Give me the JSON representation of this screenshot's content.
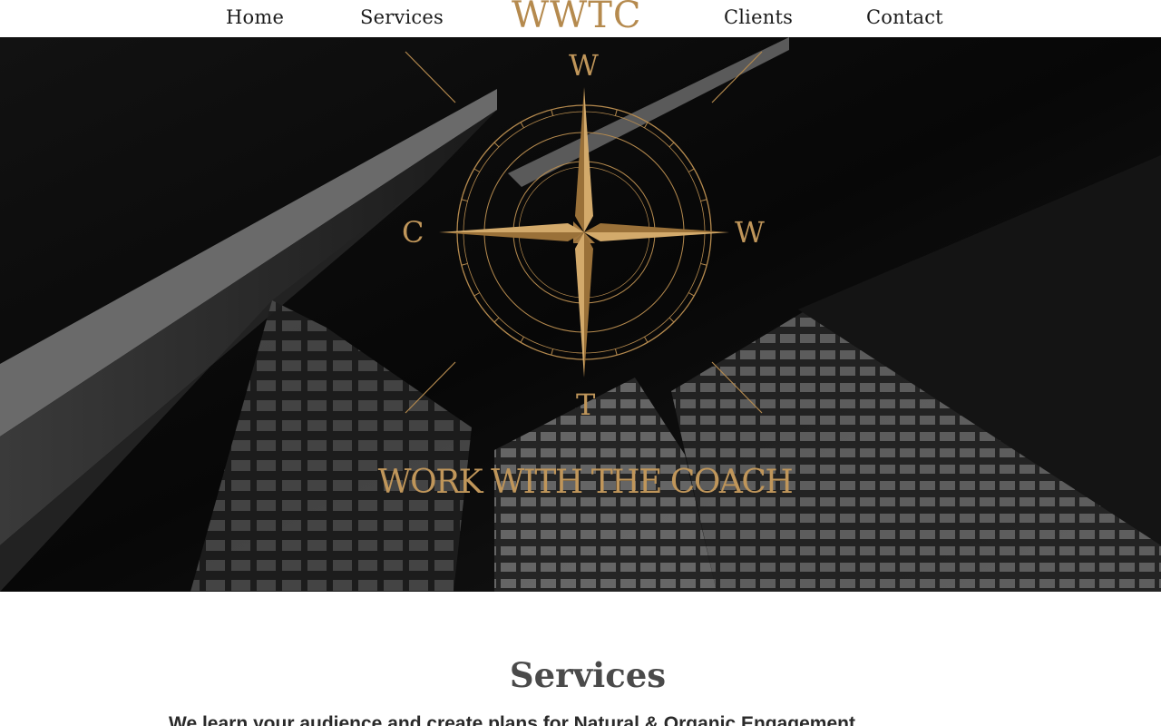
{
  "nav": {
    "home": "Home",
    "services": "Services",
    "logo": "WWTC",
    "clients": "Clients",
    "contact": "Contact"
  },
  "hero": {
    "compass_letters": {
      "top": "W",
      "left": "C",
      "right": "W",
      "bottom": "T"
    },
    "tagline": "WORK WITH THE COACH"
  },
  "services": {
    "title": "Services",
    "subtitle": "We learn your audience and create plans for Natural & Organic Engagement"
  },
  "colors": {
    "gold": "#b58a4e",
    "hero_bg": "#050505"
  },
  "icons": {
    "compass": "compass-rose-icon"
  }
}
